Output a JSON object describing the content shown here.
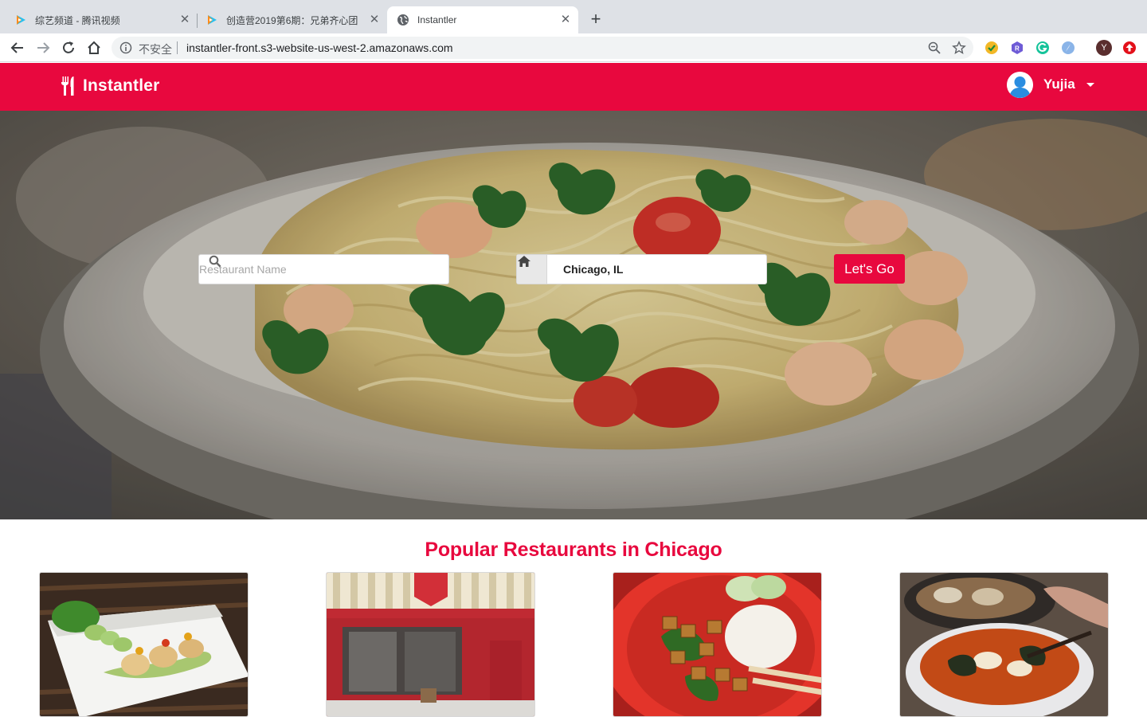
{
  "browser": {
    "tabs": [
      {
        "title": "综艺频道 - 腾讯视频",
        "active": false,
        "favicon": "tencent-video-icon"
      },
      {
        "title": "创造营2019第6期：兄弟齐心团",
        "active": false,
        "favicon": "tencent-video-icon"
      },
      {
        "title": "Instantler",
        "active": true,
        "favicon": "globe-icon"
      }
    ],
    "address": {
      "security_label": "不安全",
      "url": "instantler-front.s3-website-us-west-2.amazonaws.com"
    },
    "profile_initial": "Y"
  },
  "header": {
    "brand": "Instantler",
    "user_name": "Yujia"
  },
  "search": {
    "name_placeholder": "Restaurant Name",
    "location_value": "Chicago, IL",
    "go_label": "Let's Go"
  },
  "popular": {
    "title": "Popular Restaurants in Chicago",
    "cards": [
      {
        "image": "scallops-plate-photo"
      },
      {
        "image": "wixter-storefront-photo"
      },
      {
        "image": "tofu-rice-bowl-photo"
      },
      {
        "image": "soup-bowl-photo"
      }
    ]
  },
  "colors": {
    "brand_red": "#e8083e",
    "chrome_gray": "#dee1e6"
  }
}
